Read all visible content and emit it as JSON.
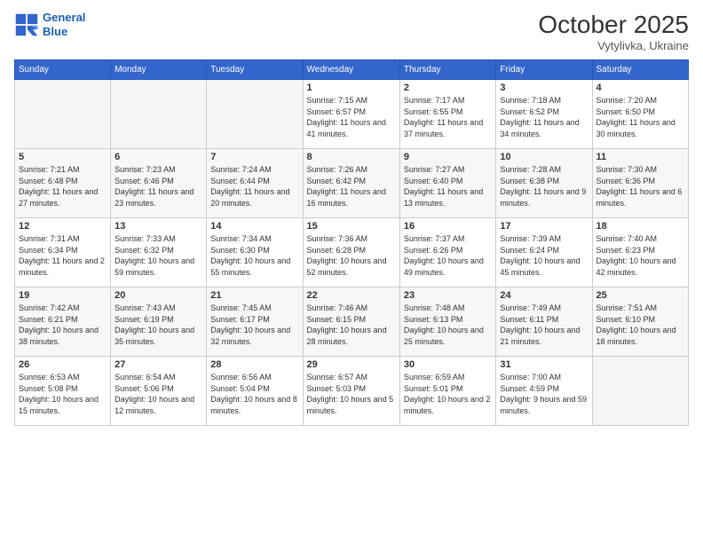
{
  "logo": {
    "line1": "General",
    "line2": "Blue"
  },
  "title": "October 2025",
  "location": "Vytylivka, Ukraine",
  "days_of_week": [
    "Sunday",
    "Monday",
    "Tuesday",
    "Wednesday",
    "Thursday",
    "Friday",
    "Saturday"
  ],
  "weeks": [
    [
      {
        "day": "",
        "sunrise": "",
        "sunset": "",
        "daylight": "",
        "empty": true
      },
      {
        "day": "",
        "sunrise": "",
        "sunset": "",
        "daylight": "",
        "empty": true
      },
      {
        "day": "",
        "sunrise": "",
        "sunset": "",
        "daylight": "",
        "empty": true
      },
      {
        "day": "1",
        "sunrise": "Sunrise: 7:15 AM",
        "sunset": "Sunset: 6:57 PM",
        "daylight": "Daylight: 11 hours and 41 minutes."
      },
      {
        "day": "2",
        "sunrise": "Sunrise: 7:17 AM",
        "sunset": "Sunset: 6:55 PM",
        "daylight": "Daylight: 11 hours and 37 minutes."
      },
      {
        "day": "3",
        "sunrise": "Sunrise: 7:18 AM",
        "sunset": "Sunset: 6:52 PM",
        "daylight": "Daylight: 11 hours and 34 minutes."
      },
      {
        "day": "4",
        "sunrise": "Sunrise: 7:20 AM",
        "sunset": "Sunset: 6:50 PM",
        "daylight": "Daylight: 11 hours and 30 minutes."
      }
    ],
    [
      {
        "day": "5",
        "sunrise": "Sunrise: 7:21 AM",
        "sunset": "Sunset: 6:48 PM",
        "daylight": "Daylight: 11 hours and 27 minutes."
      },
      {
        "day": "6",
        "sunrise": "Sunrise: 7:23 AM",
        "sunset": "Sunset: 6:46 PM",
        "daylight": "Daylight: 11 hours and 23 minutes."
      },
      {
        "day": "7",
        "sunrise": "Sunrise: 7:24 AM",
        "sunset": "Sunset: 6:44 PM",
        "daylight": "Daylight: 11 hours and 20 minutes."
      },
      {
        "day": "8",
        "sunrise": "Sunrise: 7:26 AM",
        "sunset": "Sunset: 6:42 PM",
        "daylight": "Daylight: 11 hours and 16 minutes."
      },
      {
        "day": "9",
        "sunrise": "Sunrise: 7:27 AM",
        "sunset": "Sunset: 6:40 PM",
        "daylight": "Daylight: 11 hours and 13 minutes."
      },
      {
        "day": "10",
        "sunrise": "Sunrise: 7:28 AM",
        "sunset": "Sunset: 6:38 PM",
        "daylight": "Daylight: 11 hours and 9 minutes."
      },
      {
        "day": "11",
        "sunrise": "Sunrise: 7:30 AM",
        "sunset": "Sunset: 6:36 PM",
        "daylight": "Daylight: 11 hours and 6 minutes."
      }
    ],
    [
      {
        "day": "12",
        "sunrise": "Sunrise: 7:31 AM",
        "sunset": "Sunset: 6:34 PM",
        "daylight": "Daylight: 11 hours and 2 minutes."
      },
      {
        "day": "13",
        "sunrise": "Sunrise: 7:33 AM",
        "sunset": "Sunset: 6:32 PM",
        "daylight": "Daylight: 10 hours and 59 minutes."
      },
      {
        "day": "14",
        "sunrise": "Sunrise: 7:34 AM",
        "sunset": "Sunset: 6:30 PM",
        "daylight": "Daylight: 10 hours and 55 minutes."
      },
      {
        "day": "15",
        "sunrise": "Sunrise: 7:36 AM",
        "sunset": "Sunset: 6:28 PM",
        "daylight": "Daylight: 10 hours and 52 minutes."
      },
      {
        "day": "16",
        "sunrise": "Sunrise: 7:37 AM",
        "sunset": "Sunset: 6:26 PM",
        "daylight": "Daylight: 10 hours and 49 minutes."
      },
      {
        "day": "17",
        "sunrise": "Sunrise: 7:39 AM",
        "sunset": "Sunset: 6:24 PM",
        "daylight": "Daylight: 10 hours and 45 minutes."
      },
      {
        "day": "18",
        "sunrise": "Sunrise: 7:40 AM",
        "sunset": "Sunset: 6:23 PM",
        "daylight": "Daylight: 10 hours and 42 minutes."
      }
    ],
    [
      {
        "day": "19",
        "sunrise": "Sunrise: 7:42 AM",
        "sunset": "Sunset: 6:21 PM",
        "daylight": "Daylight: 10 hours and 38 minutes."
      },
      {
        "day": "20",
        "sunrise": "Sunrise: 7:43 AM",
        "sunset": "Sunset: 6:19 PM",
        "daylight": "Daylight: 10 hours and 35 minutes."
      },
      {
        "day": "21",
        "sunrise": "Sunrise: 7:45 AM",
        "sunset": "Sunset: 6:17 PM",
        "daylight": "Daylight: 10 hours and 32 minutes."
      },
      {
        "day": "22",
        "sunrise": "Sunrise: 7:46 AM",
        "sunset": "Sunset: 6:15 PM",
        "daylight": "Daylight: 10 hours and 28 minutes."
      },
      {
        "day": "23",
        "sunrise": "Sunrise: 7:48 AM",
        "sunset": "Sunset: 6:13 PM",
        "daylight": "Daylight: 10 hours and 25 minutes."
      },
      {
        "day": "24",
        "sunrise": "Sunrise: 7:49 AM",
        "sunset": "Sunset: 6:11 PM",
        "daylight": "Daylight: 10 hours and 21 minutes."
      },
      {
        "day": "25",
        "sunrise": "Sunrise: 7:51 AM",
        "sunset": "Sunset: 6:10 PM",
        "daylight": "Daylight: 10 hours and 18 minutes."
      }
    ],
    [
      {
        "day": "26",
        "sunrise": "Sunrise: 6:53 AM",
        "sunset": "Sunset: 5:08 PM",
        "daylight": "Daylight: 10 hours and 15 minutes."
      },
      {
        "day": "27",
        "sunrise": "Sunrise: 6:54 AM",
        "sunset": "Sunset: 5:06 PM",
        "daylight": "Daylight: 10 hours and 12 minutes."
      },
      {
        "day": "28",
        "sunrise": "Sunrise: 6:56 AM",
        "sunset": "Sunset: 5:04 PM",
        "daylight": "Daylight: 10 hours and 8 minutes."
      },
      {
        "day": "29",
        "sunrise": "Sunrise: 6:57 AM",
        "sunset": "Sunset: 5:03 PM",
        "daylight": "Daylight: 10 hours and 5 minutes."
      },
      {
        "day": "30",
        "sunrise": "Sunrise: 6:59 AM",
        "sunset": "Sunset: 5:01 PM",
        "daylight": "Daylight: 10 hours and 2 minutes."
      },
      {
        "day": "31",
        "sunrise": "Sunrise: 7:00 AM",
        "sunset": "Sunset: 4:59 PM",
        "daylight": "Daylight: 9 hours and 59 minutes."
      },
      {
        "day": "",
        "sunrise": "",
        "sunset": "",
        "daylight": "",
        "empty": true
      }
    ]
  ]
}
